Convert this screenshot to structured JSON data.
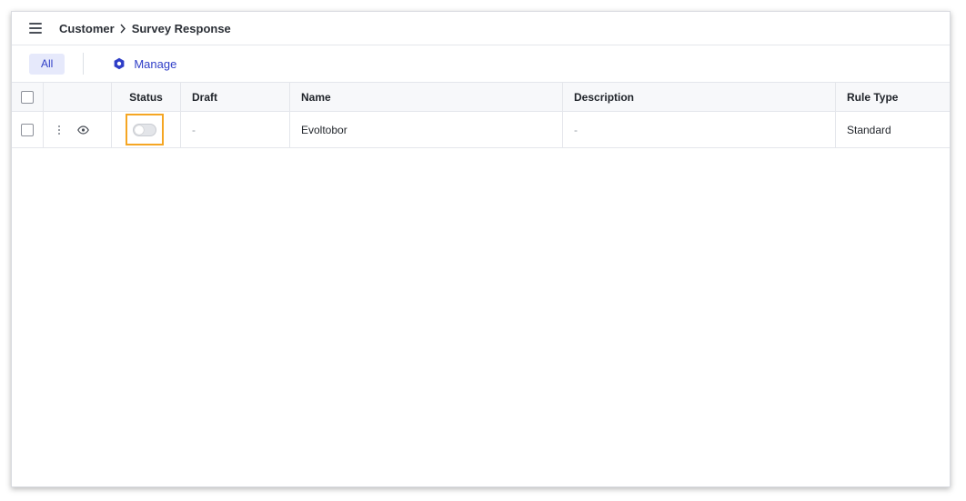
{
  "header": {
    "breadcrumb": {
      "parent": "Customer",
      "current": "Survey Response"
    }
  },
  "toolbar": {
    "tab_all_label": "All",
    "manage_label": "Manage"
  },
  "table": {
    "columns": {
      "status": "Status",
      "draft": "Draft",
      "name": "Name",
      "description": "Description",
      "rule_type": "Rule Type"
    },
    "rows": [
      {
        "status_enabled": false,
        "draft": "-",
        "name": "Evoltobor",
        "description": "-",
        "rule_type": "Standard"
      }
    ]
  },
  "colors": {
    "accent": "#2f3ec7",
    "tab_bg": "#e6e9fb",
    "highlight": "#f5a623"
  },
  "icons": [
    "menu-icon",
    "chevron-right-icon",
    "gear-icon",
    "more-vertical-icon",
    "eye-icon"
  ]
}
